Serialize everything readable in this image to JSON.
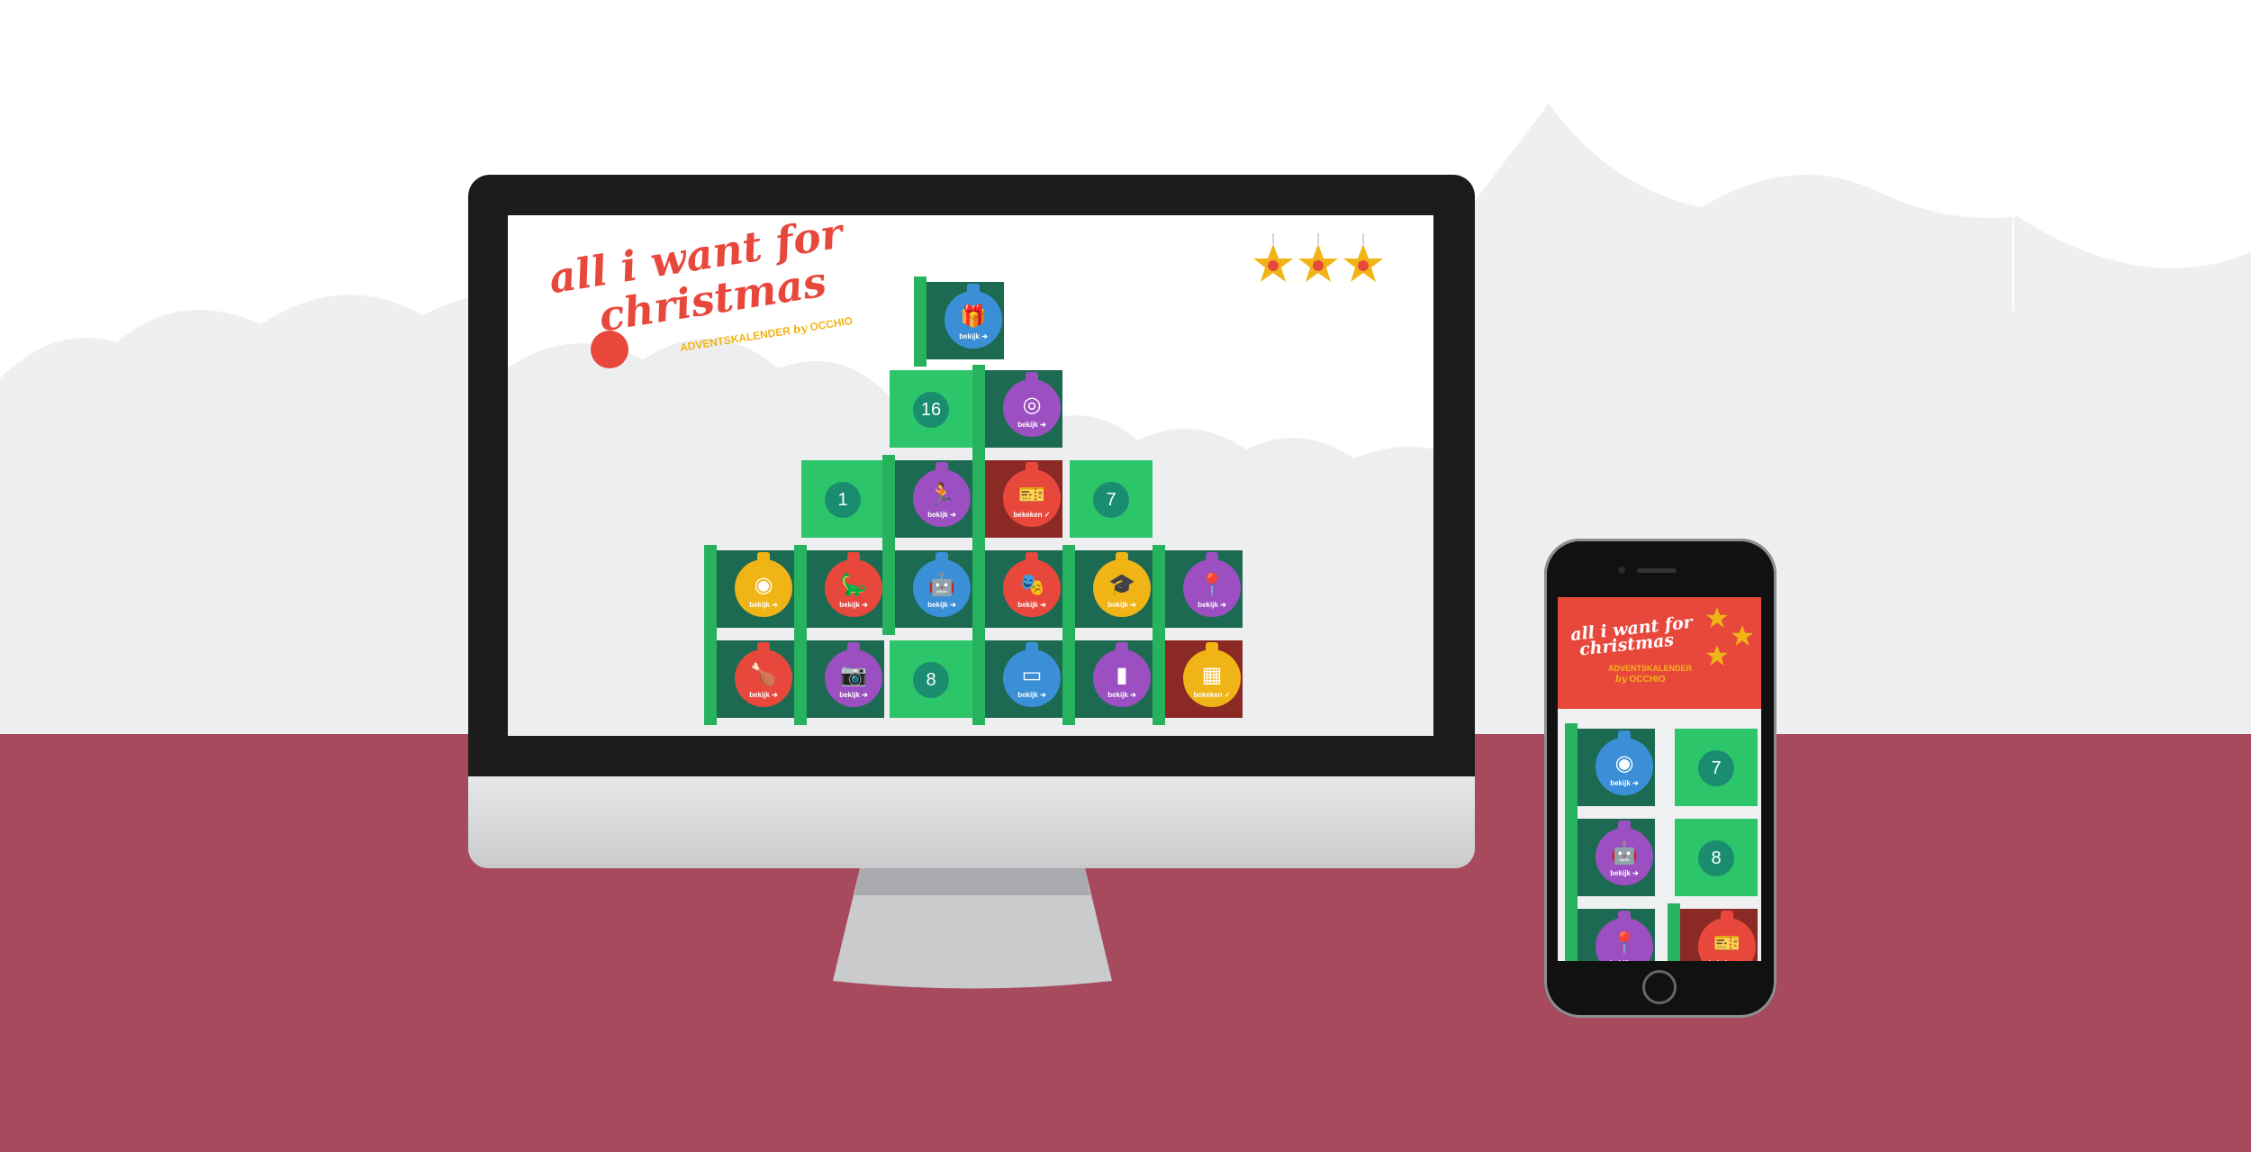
{
  "colors": {
    "floor": "#a84a5e",
    "cloud": "#eeeff0",
    "title_red": "#e8483c",
    "subtitle_yellow": "#f1b416",
    "box_green": "#2dc56a",
    "box_dark": "#1d6a52",
    "number_circle": "#1a8c6f"
  },
  "desktop": {
    "title_line1": "all i want for",
    "title_line2": "christmas",
    "subtitle": "ADVENTSKALENDER",
    "by_label": "by",
    "brand": "OCCHIO",
    "social_icons": [
      "twitter-icon",
      "facebook-icon",
      "google-plus-icon"
    ],
    "boxes": {
      "top": {
        "label": "bekijk",
        "icon": "gift-icon",
        "color": "#3a8fd6"
      },
      "r2a": {
        "number": "16"
      },
      "r2b": {
        "label": "bekijk",
        "icon": "cd-icon",
        "color": "#9b4fc0"
      },
      "r3a": {
        "number": "1"
      },
      "r3b": {
        "label": "bekijk",
        "icon": "runner-icon",
        "color": "#9b4fc0"
      },
      "r3c": {
        "label": "bekeken",
        "icon": "ticket-icon",
        "color": "#e8483c"
      },
      "r3d": {
        "number": "7"
      },
      "r4a": {
        "label": "bekijk",
        "icon": "film-reel-icon",
        "color": "#f1b416"
      },
      "r4b": {
        "label": "bekijk",
        "icon": "dinosaur-icon",
        "color": "#e8483c"
      },
      "r4c": {
        "label": "bekijk",
        "icon": "robot-icon",
        "color": "#3a8fd6"
      },
      "r4d": {
        "label": "bekijk",
        "icon": "theater-masks-icon",
        "color": "#e8483c"
      },
      "r4e": {
        "label": "bekijk",
        "icon": "graduation-cap-icon",
        "color": "#f1b416"
      },
      "r4f": {
        "label": "bekijk",
        "icon": "location-pin-icon",
        "color": "#9b4fc0"
      },
      "r5a": {
        "label": "bekijk",
        "icon": "turkey-icon",
        "color": "#e8483c"
      },
      "r5b": {
        "label": "bekijk",
        "icon": "camera-icon",
        "color": "#9b4fc0"
      },
      "r5c": {
        "number": "8"
      },
      "r5d": {
        "label": "bekijk",
        "icon": "sign-icon",
        "color": "#3a8fd6"
      },
      "r5e": {
        "label": "bekijk",
        "icon": "usb-stick-icon",
        "color": "#9b4fc0"
      },
      "r5f": {
        "label": "bekeken",
        "icon": "calendar-grid-icon",
        "color": "#f1b416"
      }
    }
  },
  "mobile": {
    "header_bg": "#e8483c",
    "title_line1": "all i want for",
    "title_line2": "christmas",
    "subtitle": "ADVENTSKALENDER",
    "by_label": "by",
    "brand": "OCCHIO",
    "boxes": {
      "m1": {
        "label": "bekijk",
        "icon": "film-reel-icon",
        "color": "#3a8fd6"
      },
      "m2": {
        "number": "7"
      },
      "m3": {
        "label": "bekijk",
        "icon": "robot-icon",
        "color": "#9b4fc0"
      },
      "m4": {
        "number": "8"
      },
      "m5": {
        "label": "bekijk",
        "icon": "location-pin-icon",
        "color": "#9b4fc0"
      },
      "m6": {
        "label": "bekeken",
        "icon": "ticket-icon",
        "color": "#e8483c"
      }
    }
  }
}
